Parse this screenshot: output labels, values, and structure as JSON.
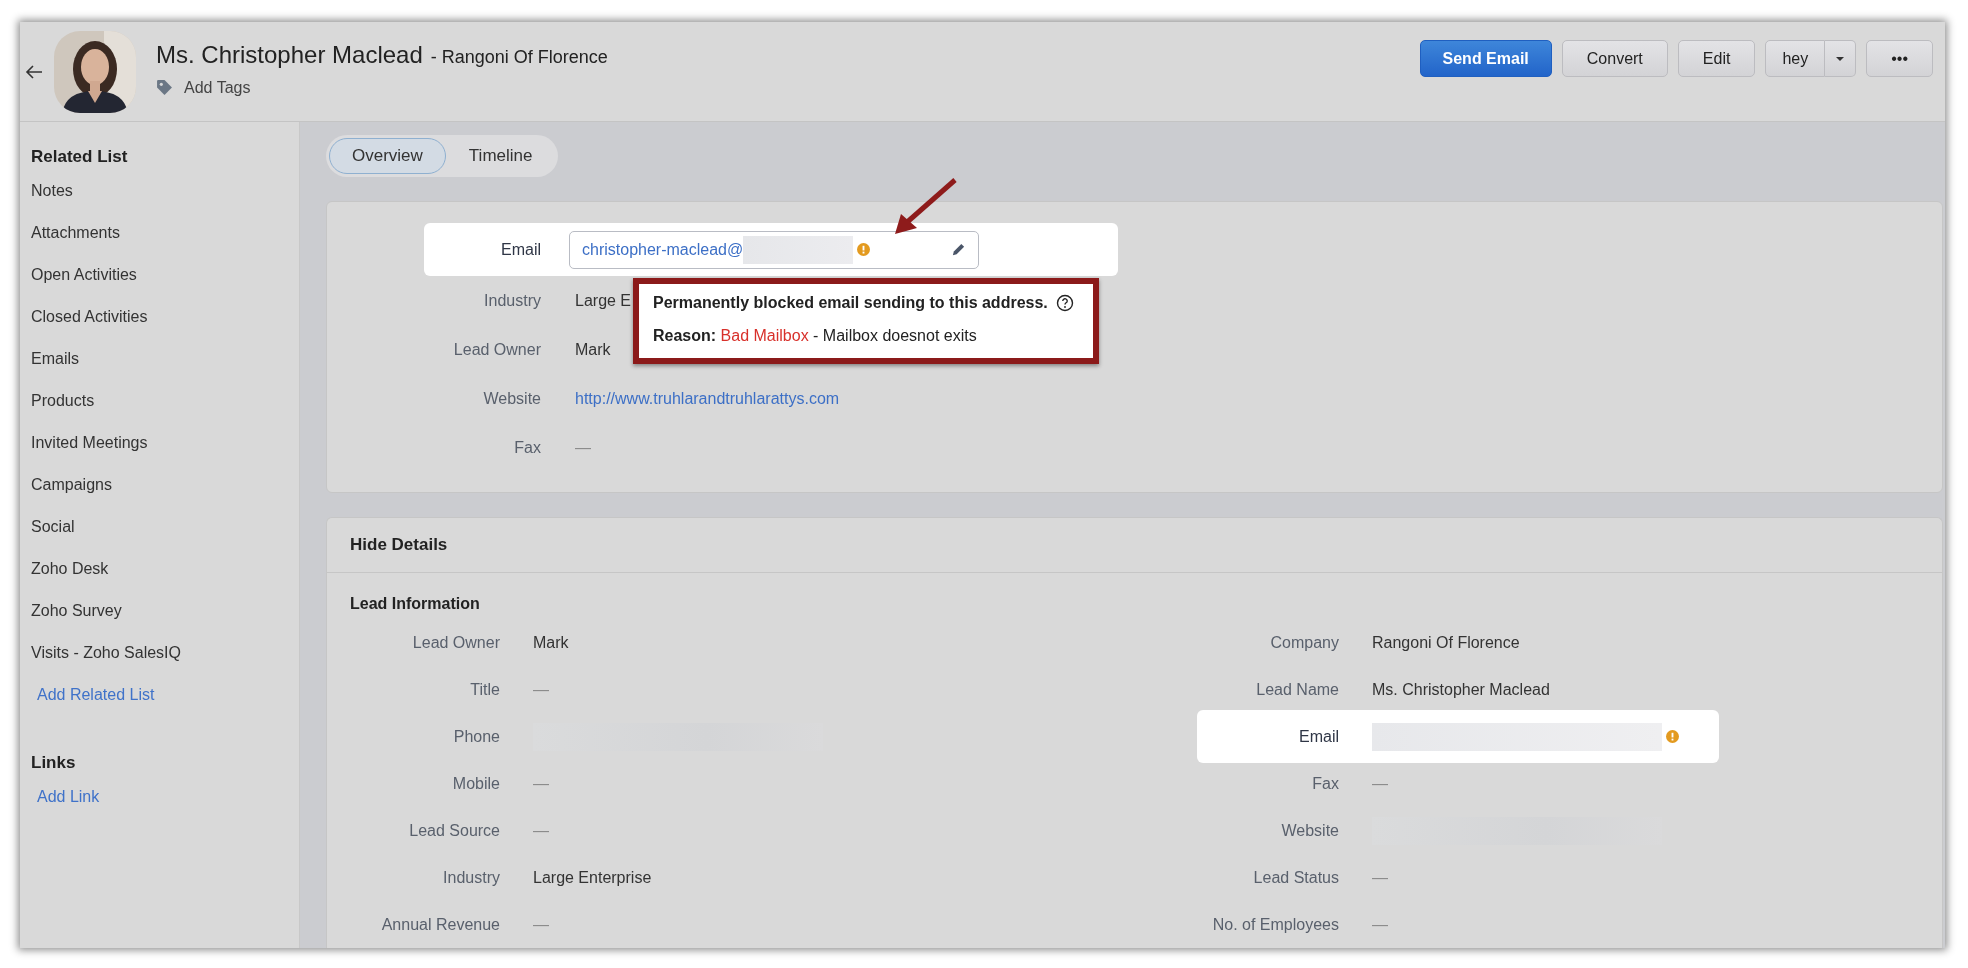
{
  "header": {
    "name": "Ms. Christopher Maclead",
    "company": "- Rangoni Of Florence",
    "tags_label": "Add Tags",
    "buttons": [
      {
        "label": "Send Email",
        "kind": "primary"
      },
      {
        "label": "Convert",
        "kind": "plain"
      },
      {
        "label": "Edit",
        "kind": "plain"
      },
      {
        "label": "hey",
        "kind": "split"
      },
      {
        "label": "•••",
        "kind": "plain"
      }
    ]
  },
  "sidebar": {
    "title": "Related List",
    "items": [
      "Notes",
      "Attachments",
      "Open Activities",
      "Closed Activities",
      "Emails",
      "Products",
      "Invited Meetings",
      "Campaigns",
      "Social",
      "Zoho Desk",
      "Zoho Survey",
      "Visits - Zoho SalesIQ"
    ],
    "add_link": "Add Related List",
    "links_title": "Links",
    "links_add": "Add Link"
  },
  "tabs": [
    {
      "label": "Overview",
      "selected": true
    },
    {
      "label": "Timeline",
      "selected": false
    }
  ],
  "overview": [
    {
      "label": "Email",
      "kind": "email",
      "value": "christopher-maclead@",
      "highlighted": true,
      "warning": true
    },
    {
      "label": "Industry",
      "kind": "text",
      "value": "Large E",
      "highlighted": false
    },
    {
      "label": "Lead Owner",
      "kind": "text",
      "value": "Mark",
      "highlighted": false
    },
    {
      "label": "Website",
      "kind": "link",
      "value": "http://www.truhlarandtruhlarattys.com",
      "highlighted": false
    },
    {
      "label": "Fax",
      "kind": "empty",
      "value": "—",
      "highlighted": false
    }
  ],
  "tooltip": {
    "message": "Permanently blocked email sending to this address.",
    "reason_label": "Reason:",
    "reason": "Bad Mailbox",
    "detail": "- Mailbox doesnot exits"
  },
  "details": {
    "toggle": "Hide Details",
    "section": "Lead Information",
    "left": [
      {
        "label": "Lead Owner",
        "kind": "text",
        "value": "Mark",
        "highlighted": false
      },
      {
        "label": "Title",
        "kind": "empty",
        "value": "—",
        "highlighted": false
      },
      {
        "label": "Phone",
        "kind": "redacted",
        "highlighted": false
      },
      {
        "label": "Mobile",
        "kind": "empty",
        "value": "—",
        "highlighted": false
      },
      {
        "label": "Lead Source",
        "kind": "empty",
        "value": "—",
        "highlighted": false
      },
      {
        "label": "Industry",
        "kind": "text",
        "value": "Large Enterprise",
        "highlighted": false
      },
      {
        "label": "Annual Revenue",
        "kind": "empty",
        "value": "—",
        "highlighted": false
      }
    ],
    "right": [
      {
        "label": "Company",
        "kind": "text",
        "value": "Rangoni Of Florence",
        "highlighted": false
      },
      {
        "label": "Lead Name",
        "kind": "text",
        "value": "Ms. Christopher Maclead",
        "highlighted": false
      },
      {
        "label": "Email",
        "kind": "redacted",
        "highlighted": true,
        "warning": true
      },
      {
        "label": "Fax",
        "kind": "empty",
        "value": "—",
        "highlighted": false
      },
      {
        "label": "Website",
        "kind": "redacted",
        "highlighted": false
      },
      {
        "label": "Lead Status",
        "kind": "empty",
        "value": "—",
        "highlighted": false
      },
      {
        "label": "No. of Employees",
        "kind": "empty",
        "value": "—",
        "highlighted": false
      }
    ]
  }
}
